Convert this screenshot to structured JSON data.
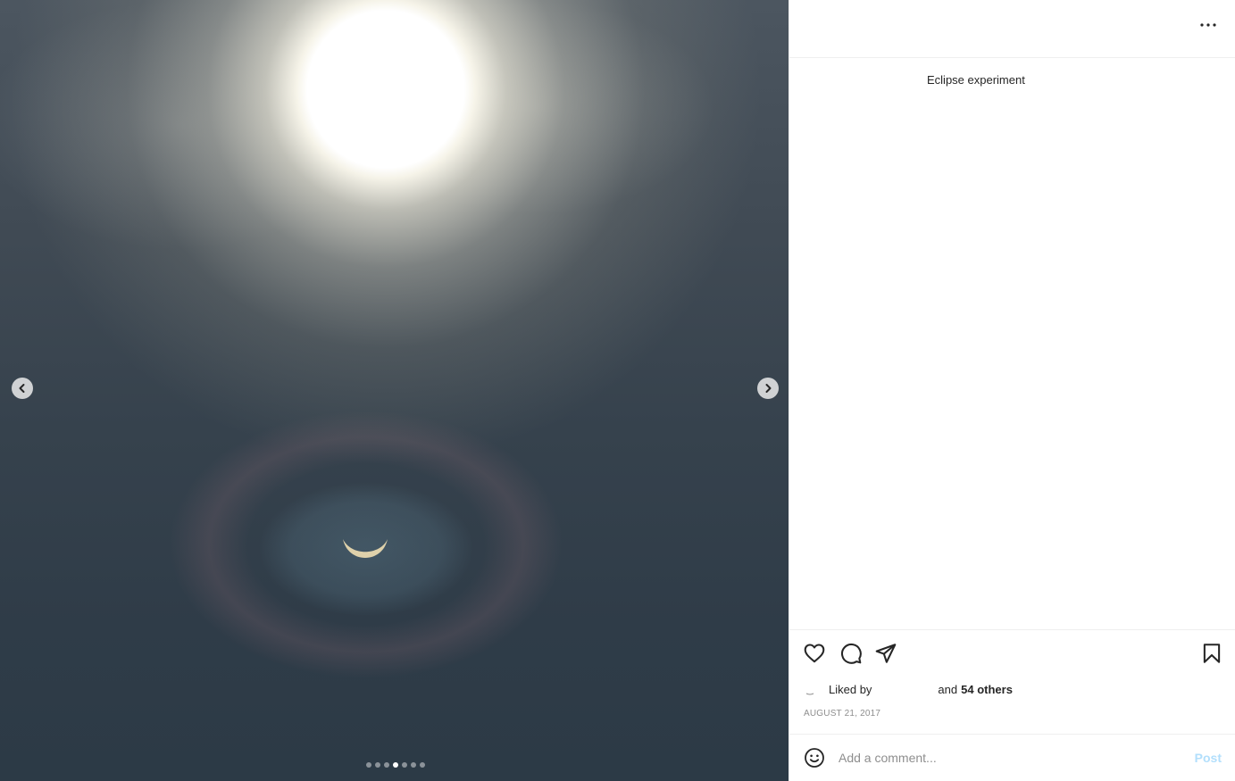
{
  "media": {
    "dot_count": 7,
    "active_dot": 3
  },
  "post": {
    "caption": "Eclipse experiment",
    "liked_by_prefix": "Liked by",
    "and_text": "and",
    "others_text": "54 others",
    "date": "AUGUST 21, 2017"
  },
  "comment": {
    "placeholder": "Add a comment...",
    "post_label": "Post"
  },
  "icons": {
    "more": "more-horizontal-icon",
    "like": "heart-icon",
    "comment": "comment-bubble-icon",
    "share": "paper-plane-icon",
    "save": "bookmark-icon",
    "emoji": "smiley-icon",
    "prev": "chevron-left-icon",
    "next": "chevron-right-icon"
  },
  "colors": {
    "post_button": "#b2dffc",
    "date_text": "#8e8e8e",
    "text": "#262626"
  }
}
